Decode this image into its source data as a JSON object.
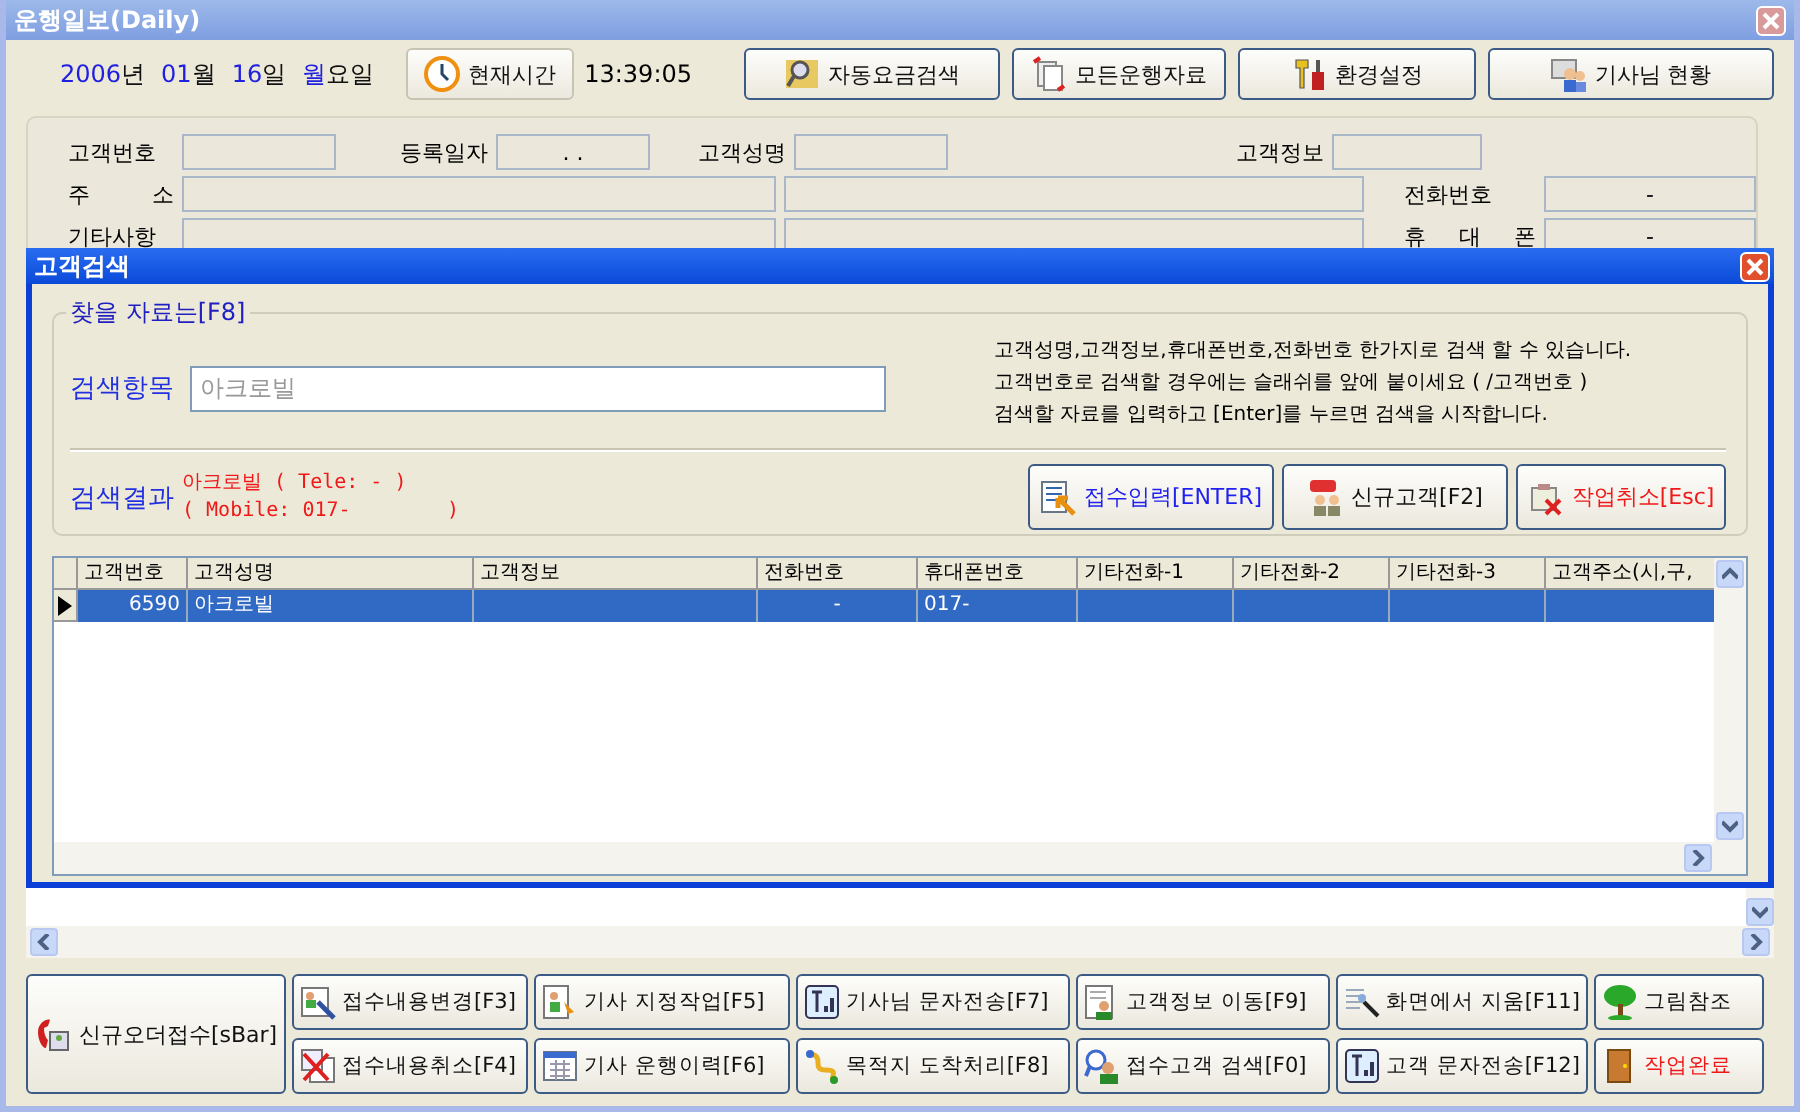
{
  "window": {
    "title": "운행일보(Daily)"
  },
  "date_parts": [
    {
      "text": "2006",
      "kind": "value"
    },
    {
      "text": "년",
      "kind": "unit"
    },
    {
      "text": "01",
      "kind": "value"
    },
    {
      "text": "월",
      "kind": "unit"
    },
    {
      "text": "16",
      "kind": "value"
    },
    {
      "text": "일",
      "kind": "unit"
    },
    {
      "text": "월",
      "kind": "value"
    },
    {
      "text": "요일",
      "kind": "unit"
    }
  ],
  "clock_button": "현재시간",
  "time": "13:39:05",
  "top_buttons": [
    "자동요금검색",
    "모든운행자료",
    "환경설정",
    "기사님 현황"
  ],
  "form": {
    "rows": [
      [
        {
          "label": "고객번호"
        },
        {
          "label": "등록일자",
          "value": ".   ."
        },
        {
          "label": "고객성명"
        },
        {
          "label": "고객정보"
        }
      ],
      [
        {
          "label": "주 소"
        },
        {},
        {
          "label": "전화번호",
          "value": "-"
        }
      ],
      [
        {
          "label": "기타사항"
        },
        {},
        {
          "label": "휴 대 폰",
          "value": "-"
        }
      ]
    ]
  },
  "dialog": {
    "title": "고객검색",
    "group_title": "찾을 자료는[F8]",
    "search_label": "검색항목",
    "search_value": "아크로빌",
    "help_lines": [
      "고객성명,고객정보,휴대폰번호,전화번호 한가지로 검색 할 수 있습니다.",
      "고객번호로 검색할 경우에는 슬래쉬를 앞에 붙이세요 ( /고객번호 )",
      "검색할 자료를 입력하고 [Enter]를 누르면 검색을 시작합니다."
    ],
    "result_label": "검색결과",
    "result_lines": [
      "아크로빌 ( Tele: - )",
      "( Mobile: 017-        )"
    ],
    "buttons": [
      {
        "label": "접수입력[ENTER]",
        "kind": "primary"
      },
      {
        "label": "신규고객[F2]",
        "kind": "normal"
      },
      {
        "label": "작업취소[Esc]",
        "kind": "danger"
      }
    ],
    "table": {
      "columns": [
        "고객번호",
        "고객성명",
        "고객정보",
        "전화번호",
        "휴대폰번호",
        "기타전화-1",
        "기타전화-2",
        "기타전화-3",
        "고객주소(시,구,"
      ],
      "rows": [
        {
          "selected": true,
          "cells": [
            "6590",
            "아크로빌",
            null,
            "-",
            "017-",
            null,
            null,
            null,
            null
          ]
        }
      ]
    }
  },
  "bottom_left_button": "신규오더접수[sBar]",
  "bottom_buttons": [
    {
      "label": "접수내용변경[F3]",
      "kind": "normal"
    },
    {
      "label": "기사 지정작업[F5]",
      "kind": "normal"
    },
    {
      "label": "기사님 문자전송[F7]",
      "kind": "normal"
    },
    {
      "label": "고객정보 이동[F9]",
      "kind": "normal"
    },
    {
      "label": "화면에서 지움[F11]",
      "kind": "normal"
    },
    {
      "label": "그림참조",
      "kind": "normal"
    },
    {
      "label": "접수내용취소[F4]",
      "kind": "normal"
    },
    {
      "label": "기사 운행이력[F6]",
      "kind": "normal"
    },
    {
      "label": "목적지 도착처리[F8]",
      "kind": "normal"
    },
    {
      "label": "접수고객 검색[F0]",
      "kind": "normal"
    },
    {
      "label": "고객 문자전송[F12]",
      "kind": "normal"
    },
    {
      "label": "작업완료",
      "kind": "danger"
    }
  ]
}
